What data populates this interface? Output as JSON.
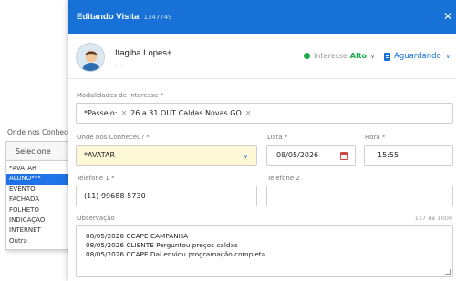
{
  "left_dropdown": {
    "label": "Onde nos Conhece",
    "placeholder": "Selecione",
    "options": [
      "*AVATAR",
      "ALUNO***",
      "EVENTO",
      "FACHADA",
      "FOLHETO",
      "INDICAÇÃO",
      "INTERNET",
      "Outra"
    ],
    "selected_index": 1
  },
  "modal": {
    "title": "Editando Visita",
    "id": "1347749",
    "close_icon": "close-icon",
    "contact": {
      "name": "Itagiba Lopes+",
      "sub": "...",
      "interest_label": "Interesse",
      "interest_value": "Alto",
      "status": "Aguardando"
    },
    "form": {
      "modalidades_label": "Modalidades de Interesse *",
      "modalidades_prefix": "*Passeio:",
      "modalidades_tag": "26 a 31 OUT Caldas Novas GO",
      "onde_label": "Onde nos Conheceu? *",
      "onde_value": "*AVATAR",
      "data_label": "Data *",
      "data_value": "08/05/2026",
      "hora_label": "Hora *",
      "hora_value": "15:55",
      "tel1_label": "Telefone 1 *",
      "tel1_value": "(11) 99688-5730",
      "tel2_label": "Telefone 2",
      "tel2_value": "",
      "obs_label": "Observação",
      "obs_counter": "117 de 1000",
      "obs_lines": [
        "08/05/2026 CCAPE CAMPANHA",
        "08/05/2026 CLIENTE Perguntou preços caldas",
        "08/05/2026 CCAPE Dai enviou programação completa"
      ]
    }
  },
  "colors": {
    "header": "#1771d6",
    "interest": "#1aa84a",
    "highlight_field": "#fdf8d6",
    "selected_option": "#1e73e8"
  }
}
